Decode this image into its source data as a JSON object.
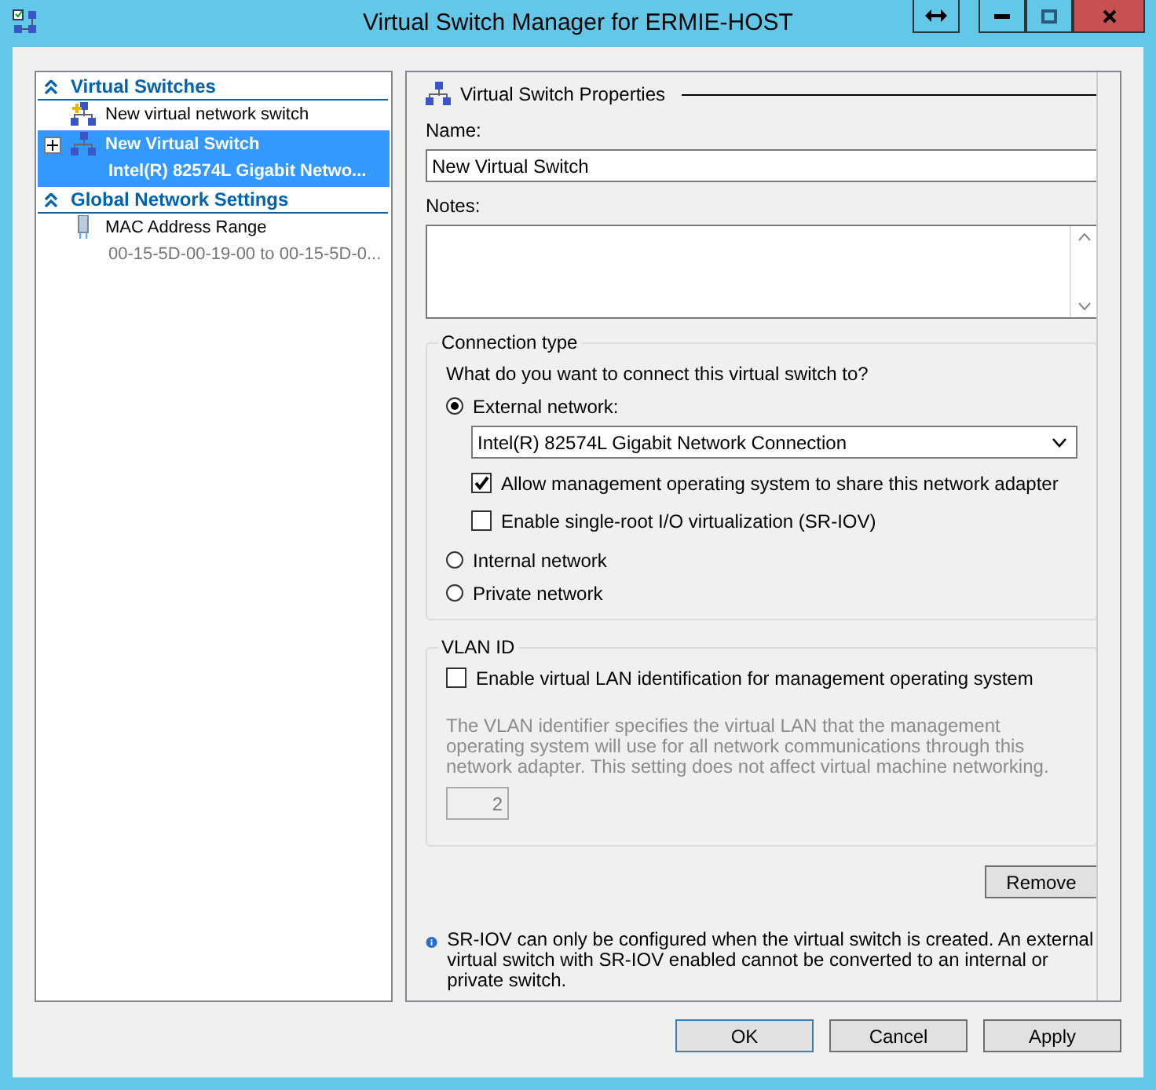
{
  "window": {
    "title": "Virtual Switch Manager for ERMIE-HOST"
  },
  "sidebar": {
    "sections": [
      {
        "label": "Virtual Switches",
        "expanded": true,
        "items": [
          {
            "kind": "action",
            "title": "New virtual network switch",
            "selected": false
          },
          {
            "kind": "switch",
            "title": "New Virtual Switch",
            "subtitle": "Intel(R) 82574L Gigabit Netwo...",
            "selected": true
          }
        ]
      },
      {
        "label": "Global Network Settings",
        "expanded": true,
        "items": [
          {
            "kind": "mac",
            "title": "MAC Address Range",
            "subtitle": "00-15-5D-00-19-00 to 00-15-5D-0...",
            "selected": false
          }
        ]
      }
    ]
  },
  "properties": {
    "heading": "Virtual Switch Properties",
    "name_label": "Name:",
    "name_value": "New Virtual Switch",
    "notes_label": "Notes:",
    "connection_type": {
      "legend": "Connection type",
      "question": "What do you want to connect this virtual switch to?",
      "options": [
        {
          "label": "External network:",
          "selected": true,
          "adapter": "Intel(R) 82574L Gigabit Network Connection",
          "checkboxes": [
            {
              "label": "Allow management operating system to share this network adapter",
              "checked": true
            },
            {
              "label": "Enable single-root I/O virtualization (SR-IOV)",
              "checked": false
            }
          ]
        },
        {
          "label": "Internal network",
          "selected": false
        },
        {
          "label": "Private network",
          "selected": false
        }
      ]
    },
    "vlan": {
      "legend": "VLAN ID",
      "checkbox": {
        "label": "Enable virtual LAN identification for management operating system",
        "checked": false
      },
      "disabled": true,
      "description": "The VLAN identifier specifies the virtual LAN that the management operating system will use for all network communications through this network adapter. This setting does not affect virtual machine networking.",
      "value": "2"
    },
    "remove_button": "Remove",
    "info": "SR-IOV can only be configured when the virtual switch is created. An external virtual switch with SR-IOV enabled cannot be converted to an internal or private switch."
  },
  "buttons": [
    {
      "label": "OK",
      "default": true
    },
    {
      "label": "Cancel",
      "default": false
    },
    {
      "label": "Apply",
      "default": false
    }
  ]
}
